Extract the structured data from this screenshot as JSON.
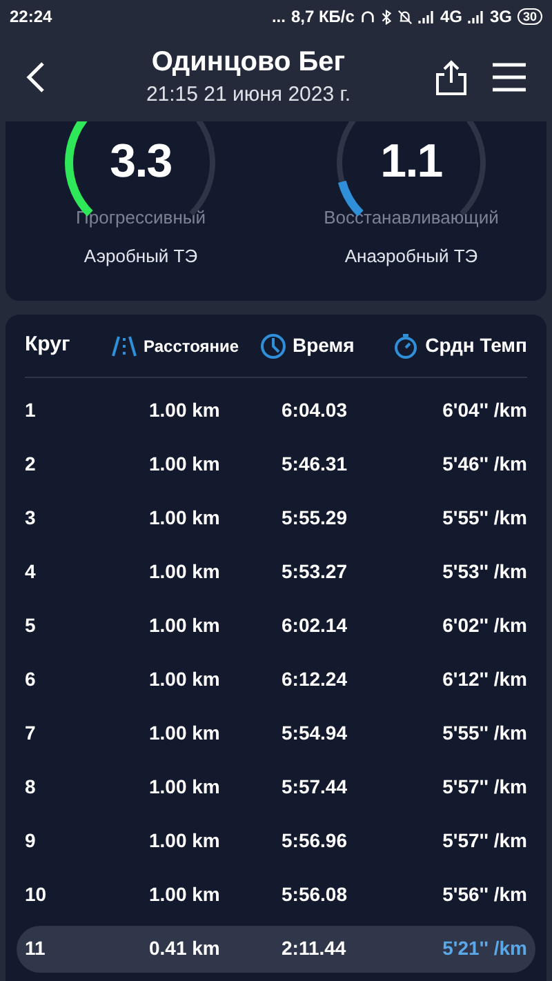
{
  "status_bar": {
    "time": "22:24",
    "dots": "...",
    "speed": "8,7 КБ/с",
    "network_1": "4G",
    "network_2": "3G",
    "battery": "30"
  },
  "header": {
    "title": "Одинцово Бег",
    "subtitle": "21:15 21 июня 2023 г."
  },
  "gauges": [
    {
      "value": "3.3",
      "status": "Прогрессивный",
      "label": "Аэробный ТЭ",
      "color": "#2ee85a"
    },
    {
      "value": "1.1",
      "status": "Восстанавливающий",
      "label": "Анаэробный ТЭ",
      "color": "#2f8fd8"
    }
  ],
  "table": {
    "columns": [
      "Круг",
      "Расстояние",
      "Время",
      "Срдн Темп"
    ],
    "rows": [
      {
        "lap": "1",
        "distance": "1.00 km",
        "time": "6:04.03",
        "pace": "6'04'' /km",
        "selected": false
      },
      {
        "lap": "2",
        "distance": "1.00 km",
        "time": "5:46.31",
        "pace": "5'46'' /km",
        "selected": false
      },
      {
        "lap": "3",
        "distance": "1.00 km",
        "time": "5:55.29",
        "pace": "5'55'' /km",
        "selected": false
      },
      {
        "lap": "4",
        "distance": "1.00 km",
        "time": "5:53.27",
        "pace": "5'53'' /km",
        "selected": false
      },
      {
        "lap": "5",
        "distance": "1.00 km",
        "time": "6:02.14",
        "pace": "6'02'' /km",
        "selected": false
      },
      {
        "lap": "6",
        "distance": "1.00 km",
        "time": "6:12.24",
        "pace": "6'12'' /km",
        "selected": false
      },
      {
        "lap": "7",
        "distance": "1.00 km",
        "time": "5:54.94",
        "pace": "5'55'' /km",
        "selected": false
      },
      {
        "lap": "8",
        "distance": "1.00 km",
        "time": "5:57.44",
        "pace": "5'57'' /km",
        "selected": false
      },
      {
        "lap": "9",
        "distance": "1.00 km",
        "time": "5:56.96",
        "pace": "5'57'' /km",
        "selected": false
      },
      {
        "lap": "10",
        "distance": "1.00 km",
        "time": "5:56.08",
        "pace": "5'56'' /km",
        "selected": false
      },
      {
        "lap": "11",
        "distance": "0.41 km",
        "time": "2:11.44",
        "pace": "5'21'' /km",
        "selected": true
      }
    ]
  }
}
